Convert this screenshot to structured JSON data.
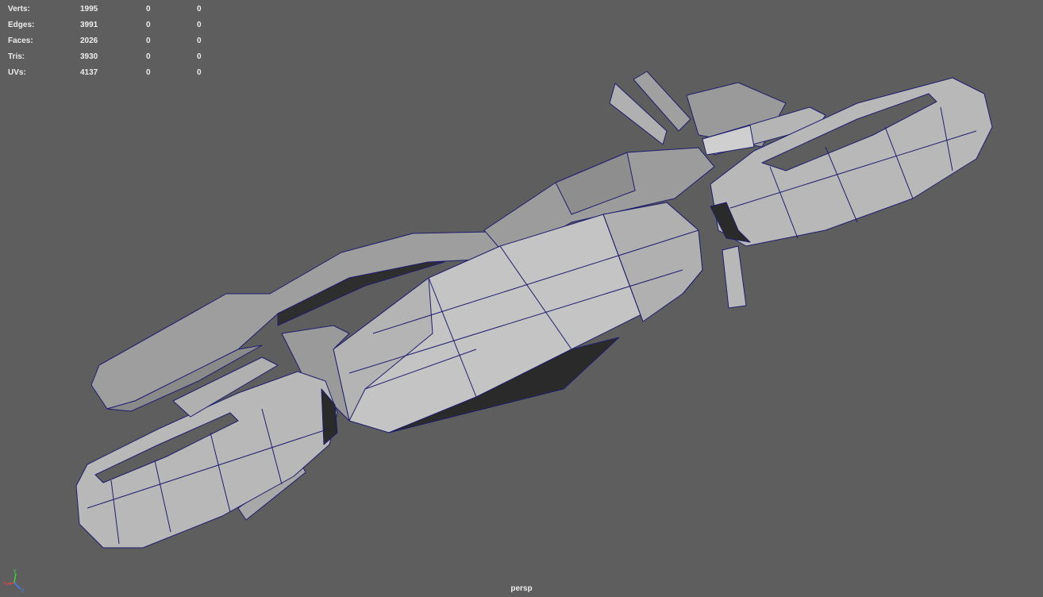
{
  "heads_up_display": {
    "rows": [
      {
        "label": "Verts:",
        "values": [
          "1995",
          "0",
          "0"
        ]
      },
      {
        "label": "Edges:",
        "values": [
          "3991",
          "0",
          "0"
        ]
      },
      {
        "label": "Faces:",
        "values": [
          "2026",
          "0",
          "0"
        ]
      },
      {
        "label": "Tris:",
        "values": [
          "3930",
          "0",
          "0"
        ]
      },
      {
        "label": "UVs:",
        "values": [
          "4137",
          "0",
          "0"
        ]
      }
    ]
  },
  "viewport": {
    "camera_name": "persp",
    "background_color": "#5e5e5e",
    "wireframe_color": "#1e1e6e",
    "shaded_face_color": "#a6a6a6",
    "shadow_face_color": "#2a2a2a"
  },
  "axis_gizmo": {
    "x_label": "x",
    "y_label": "y",
    "z_label": "z",
    "x_color": "#e04040",
    "y_color": "#40d040",
    "z_color": "#4080ff"
  }
}
